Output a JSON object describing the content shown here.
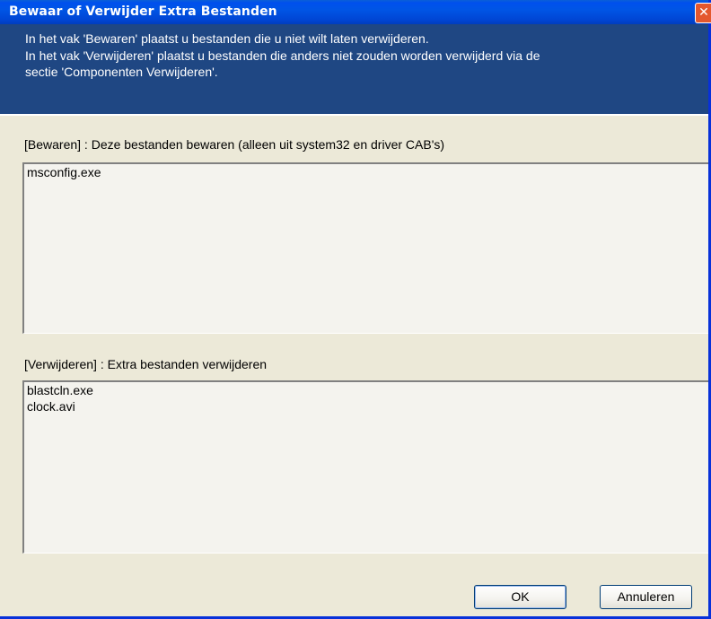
{
  "window": {
    "title": "Bewaar of Verwijder Extra Bestanden",
    "close_glyph": "✕"
  },
  "banner": {
    "line1": "In het vak 'Bewaren' plaatst u bestanden die u niet wilt laten verwijderen.",
    "line2": "In het vak 'Verwijderen' plaatst u bestanden die anders niet zouden worden verwijderd via de",
    "line3": "sectie 'Componenten Verwijderen'."
  },
  "keep": {
    "label": "[Bewaren] : Deze bestanden bewaren (alleen uit system32 en driver CAB's)",
    "items": [
      "msconfig.exe"
    ]
  },
  "remove": {
    "label": "[Verwijderen] : Extra bestanden verwijderen",
    "items": [
      "blastcln.exe",
      "clock.avi"
    ]
  },
  "buttons": {
    "ok": "OK",
    "cancel": "Annuleren"
  },
  "colors": {
    "titlebar": "#0055e5",
    "banner": "#1f4783",
    "dialog_bg": "#ece9d8",
    "close_button": "#e4572e"
  },
  "icons": {
    "close": "close-icon"
  }
}
